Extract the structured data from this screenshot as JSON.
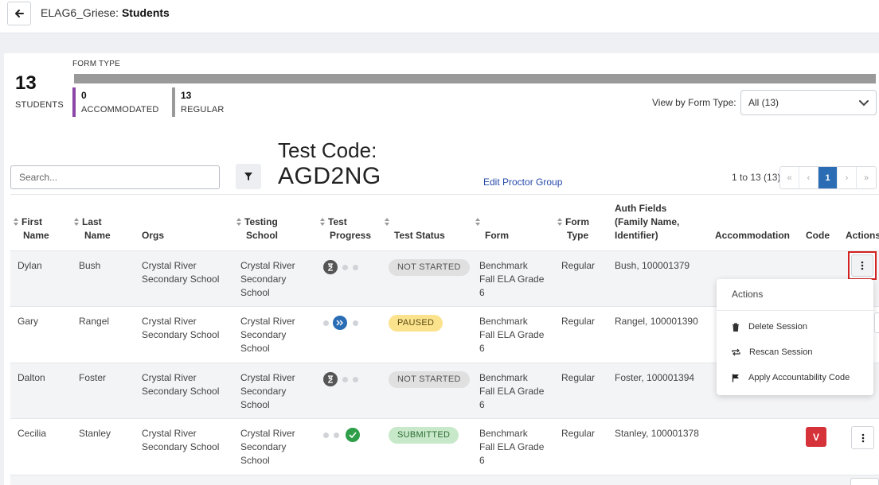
{
  "header": {
    "title_prefix": "ELAG6_Griese: ",
    "title_main": "Students"
  },
  "summary": {
    "students_count": "13",
    "students_label": "STUDENTS",
    "form_type_label": "FORM TYPE",
    "accommodated_count": "0",
    "accommodated_label": "ACCOMMODATED",
    "regular_count": "13",
    "regular_label": "REGULAR",
    "view_by_label": "View by Form Type:",
    "view_by_value": "All (13)"
  },
  "toolbar": {
    "search_placeholder": "Search...",
    "test_code_label": "Test Code:",
    "test_code_value": "AGD2NG",
    "edit_proctor_group": "Edit Proctor Group",
    "page_info": "1 to 13 (13)",
    "pager": {
      "first": "«",
      "prev": "‹",
      "current": "1",
      "next": "›",
      "last": "»"
    }
  },
  "table": {
    "headers": {
      "first_name_1": "First",
      "first_name_2": "Name",
      "last_name_1": "Last",
      "last_name_2": "Name",
      "orgs": "Orgs",
      "testing_school_1": "Testing",
      "testing_school_2": "School",
      "test_progress_1": "Test",
      "test_progress_2": "Progress",
      "test_status": "Test Status",
      "form": "Form",
      "form_type_1": "Form",
      "form_type_2": "Type",
      "auth_fields_1": "Auth Fields",
      "auth_fields_2": "(Family Name,",
      "auth_fields_3": "Identifier)",
      "accommodation": "Accommodation",
      "code": "Code",
      "actions": "Actions"
    },
    "rows": [
      {
        "first": "Dylan",
        "last": "Bush",
        "org_1": "Crystal River",
        "org_2": "Secondary School",
        "school_1": "Crystal River",
        "school_2": "Secondary",
        "school_3": "School",
        "progress": "not-started",
        "status": "NOT STARTED",
        "form_1": "Benchmark",
        "form_2": "Fall ELA Grade",
        "form_3": "6",
        "form_type": "Regular",
        "auth": "Bush, 100001379",
        "code": ""
      },
      {
        "first": "Gary",
        "last": "Rangel",
        "org_1": "Crystal River",
        "org_2": "Secondary School",
        "school_1": "Crystal River",
        "school_2": "Secondary",
        "school_3": "School",
        "progress": "paused",
        "status": "PAUSED",
        "form_1": "Benchmark",
        "form_2": "Fall ELA Grade",
        "form_3": "6",
        "form_type": "Regular",
        "auth": "Rangel, 100001390",
        "code": ""
      },
      {
        "first": "Dalton",
        "last": "Foster",
        "org_1": "Crystal River",
        "org_2": "Secondary School",
        "school_1": "Crystal River",
        "school_2": "Secondary",
        "school_3": "School",
        "progress": "not-started",
        "status": "NOT STARTED",
        "form_1": "Benchmark",
        "form_2": "Fall ELA Grade",
        "form_3": "6",
        "form_type": "Regular",
        "auth": "Foster, 100001394",
        "code": ""
      },
      {
        "first": "Cecilia",
        "last": "Stanley",
        "org_1": "Crystal River",
        "org_2": "Secondary School",
        "school_1": "Crystal River",
        "school_2": "Secondary",
        "school_3": "School",
        "progress": "submitted",
        "status": "SUBMITTED",
        "form_1": "Benchmark",
        "form_2": "Fall ELA Grade",
        "form_3": "6",
        "form_type": "Regular",
        "auth": "Stanley, 100001378",
        "code": "V"
      }
    ]
  },
  "actions_menu": {
    "title": "Actions",
    "items": [
      "Delete Session",
      "Rescan Session",
      "Apply Accountability Code"
    ]
  },
  "colors": {
    "accent_blue": "#2a6db5",
    "accommodated": "#8b46a8",
    "regular": "#9a9a9a",
    "highlight": "#d32020",
    "code_badge": "#d6323a"
  },
  "icons": [
    "back-arrow-icon",
    "filter-icon",
    "chevron-down-icon",
    "hourglass-icon",
    "fast-forward-icon",
    "check-icon",
    "more-vertical-icon",
    "trash-icon",
    "repeat-icon",
    "flag-icon"
  ]
}
